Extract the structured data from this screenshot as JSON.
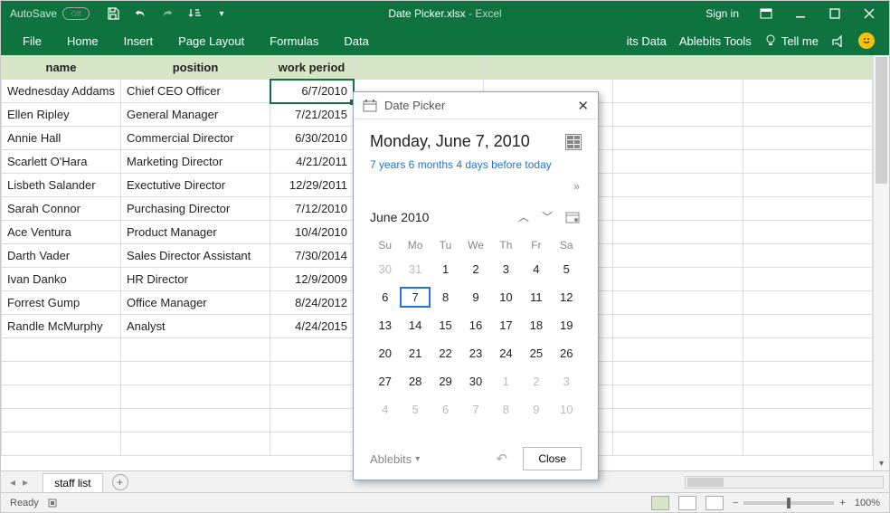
{
  "titlebar": {
    "autosave_label": "AutoSave",
    "autosave_state": "Off",
    "doc_name": "Date Picker.xlsx",
    "app_name": "Excel",
    "signin": "Sign in"
  },
  "ribbon": {
    "tabs": [
      "File",
      "Home",
      "Insert",
      "Page Layout",
      "Formulas",
      "Data"
    ],
    "right": {
      "its_data": "its Data",
      "ablebits_tools": "Ablebits Tools",
      "tell_me": "Tell me"
    }
  },
  "table": {
    "headers": {
      "a": "name",
      "b": "position",
      "c": "work period"
    },
    "rows": [
      {
        "a": "Wednesday Addams",
        "b": "Chief CEO Officer",
        "c": "6/7/2010"
      },
      {
        "a": "Ellen Ripley",
        "b": "General Manager",
        "c": "7/21/2015"
      },
      {
        "a": "Annie Hall",
        "b": "Commercial Director",
        "c": "6/30/2010"
      },
      {
        "a": "Scarlett O'Hara",
        "b": "Marketing Director",
        "c": "4/21/2011"
      },
      {
        "a": "Lisbeth Salander",
        "b": "Exectutive Director",
        "c": "12/29/2011"
      },
      {
        "a": "Sarah Connor",
        "b": "Purchasing Director",
        "c": "7/12/2010"
      },
      {
        "a": "Ace Ventura",
        "b": "Product Manager",
        "c": "10/4/2010"
      },
      {
        "a": "Darth Vader",
        "b": "Sales Director Assistant",
        "c": "7/30/2014"
      },
      {
        "a": "Ivan Danko",
        "b": "HR Director",
        "c": "12/9/2009"
      },
      {
        "a": "Forrest Gump",
        "b": "Office Manager",
        "c": "8/24/2012"
      },
      {
        "a": "Randle McMurphy",
        "b": "Analyst",
        "c": "4/24/2015"
      }
    ]
  },
  "sheettabs": {
    "active": "staff list"
  },
  "statusbar": {
    "ready": "Ready",
    "zoom": "100%"
  },
  "picker": {
    "title": "Date Picker",
    "date_long": "Monday, June 7, 2010",
    "diff": "7 years 6 months 4 days before today",
    "month_label": "June 2010",
    "dow": [
      "Su",
      "Mo",
      "Tu",
      "We",
      "Th",
      "Fr",
      "Sa"
    ],
    "cells": [
      {
        "n": "30",
        "out": true
      },
      {
        "n": "31",
        "out": true
      },
      {
        "n": "1"
      },
      {
        "n": "2"
      },
      {
        "n": "3"
      },
      {
        "n": "4"
      },
      {
        "n": "5"
      },
      {
        "n": "6"
      },
      {
        "n": "7",
        "sel": true
      },
      {
        "n": "8"
      },
      {
        "n": "9"
      },
      {
        "n": "10"
      },
      {
        "n": "11"
      },
      {
        "n": "12"
      },
      {
        "n": "13"
      },
      {
        "n": "14"
      },
      {
        "n": "15"
      },
      {
        "n": "16"
      },
      {
        "n": "17"
      },
      {
        "n": "18"
      },
      {
        "n": "19"
      },
      {
        "n": "20"
      },
      {
        "n": "21"
      },
      {
        "n": "22"
      },
      {
        "n": "23"
      },
      {
        "n": "24"
      },
      {
        "n": "25"
      },
      {
        "n": "26"
      },
      {
        "n": "27"
      },
      {
        "n": "28"
      },
      {
        "n": "29"
      },
      {
        "n": "30"
      },
      {
        "n": "1",
        "out": true
      },
      {
        "n": "2",
        "out": true
      },
      {
        "n": "3",
        "out": true
      },
      {
        "n": "4",
        "out": true
      },
      {
        "n": "5",
        "out": true
      },
      {
        "n": "6",
        "out": true
      },
      {
        "n": "7",
        "out": true
      },
      {
        "n": "8",
        "out": true
      },
      {
        "n": "9",
        "out": true
      },
      {
        "n": "10",
        "out": true
      }
    ],
    "brand": "Ablebits",
    "close_label": "Close"
  }
}
